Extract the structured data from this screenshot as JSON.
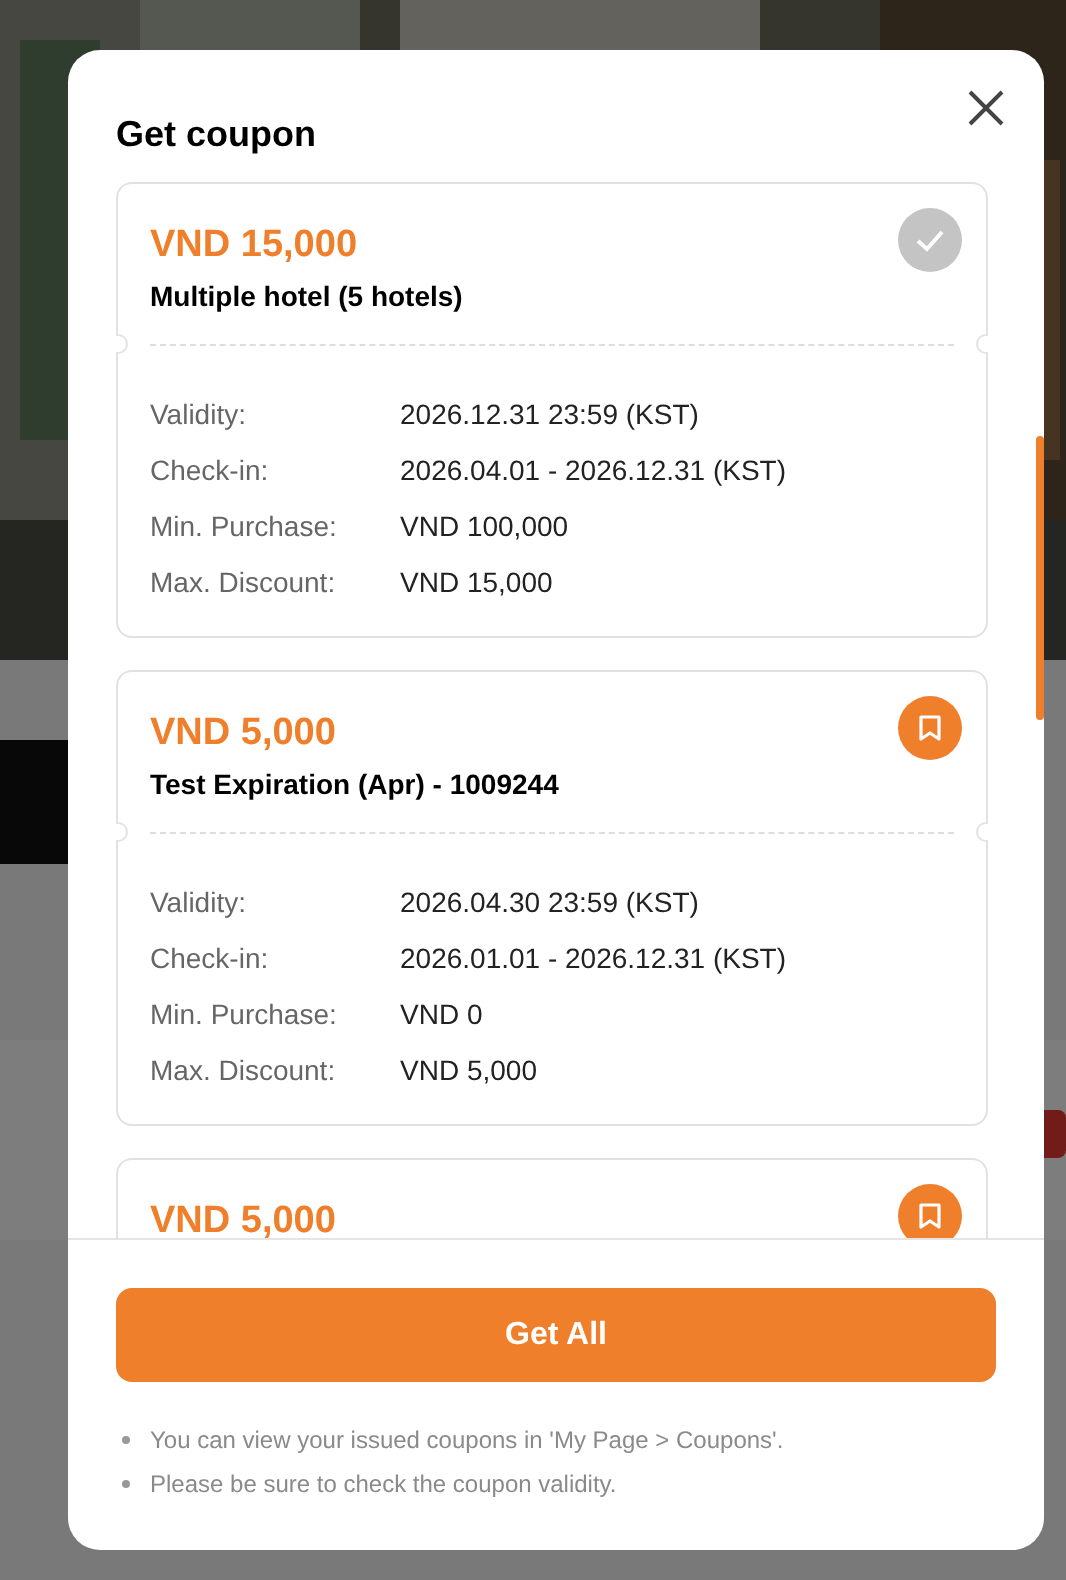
{
  "dialog": {
    "title": "Get coupon",
    "coupons": [
      {
        "amount": "VND 15,000",
        "name": "Multiple hotel (5 hotels)",
        "claimed": true,
        "details": [
          {
            "label": "Validity:",
            "value": "2026.12.31 23:59 (KST)"
          },
          {
            "label": "Check-in:",
            "value": "2026.04.01 - 2026.12.31 (KST)"
          },
          {
            "label": "Min. Purchase:",
            "value": "VND 100,000"
          },
          {
            "label": "Max. Discount:",
            "value": "VND 15,000"
          }
        ]
      },
      {
        "amount": "VND 5,000",
        "name": "Test Expiration (Apr) - 1009244",
        "claimed": false,
        "details": [
          {
            "label": "Validity:",
            "value": "2026.04.30 23:59 (KST)"
          },
          {
            "label": "Check-in:",
            "value": "2026.01.01 - 2026.12.31 (KST)"
          },
          {
            "label": "Min. Purchase:",
            "value": "VND 0"
          },
          {
            "label": "Max. Discount:",
            "value": "VND 5,000"
          }
        ]
      },
      {
        "amount": "VND 5,000",
        "claimed": false
      }
    ],
    "button": "Get All",
    "notes": [
      "You can view your issued coupons in 'My Page > Coupons'.",
      "Please be sure to check the coupon validity."
    ]
  }
}
